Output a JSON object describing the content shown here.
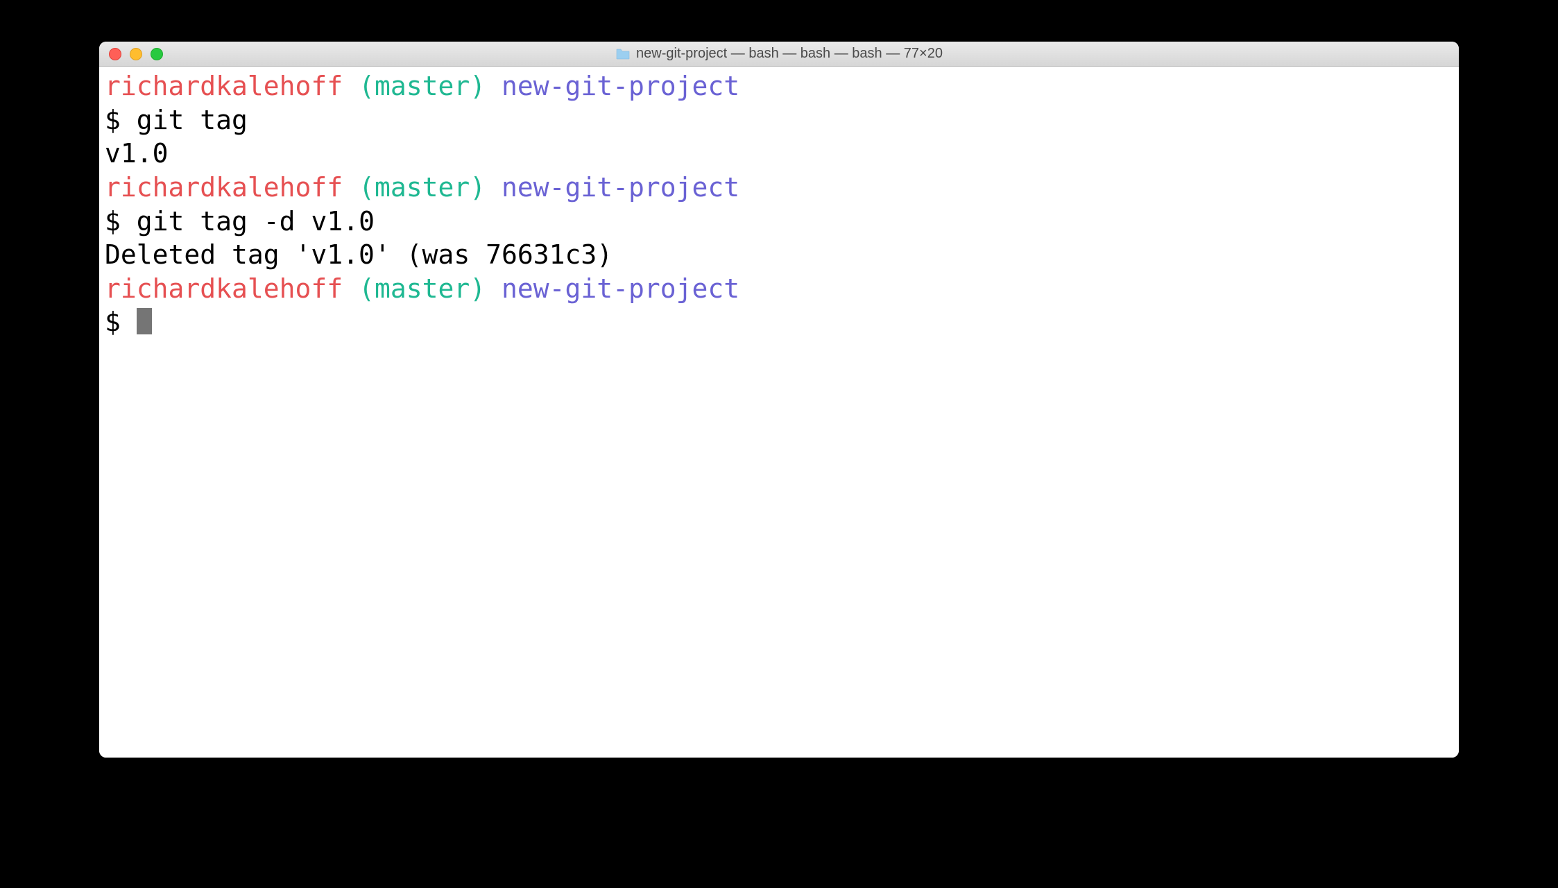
{
  "window": {
    "title": "new-git-project — bash — bash — bash — 77×20"
  },
  "prompt": {
    "user": "richardkalehoff",
    "branch_open": "(",
    "branch": "master",
    "branch_close": ")",
    "dir": "new-git-project",
    "symbol": "$"
  },
  "session": {
    "line1_cmd": "git tag",
    "line2_output": "v1.0",
    "line3_cmd": "git tag -d v1.0",
    "line4_output": "Deleted tag 'v1.0' (was 76631c3)"
  }
}
